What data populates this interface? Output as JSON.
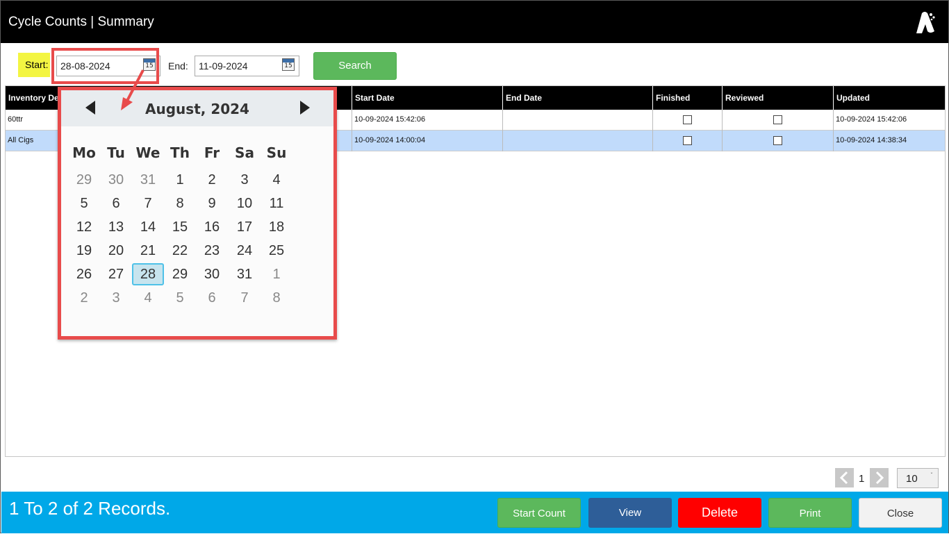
{
  "window": {
    "title": "Cycle Counts | Summary"
  },
  "filters": {
    "start_label": "Start:",
    "start_value": "28-08-2024",
    "end_label": "End:",
    "end_value": "11-09-2024",
    "calendar_icon_text": "15",
    "search_label": "Search"
  },
  "table": {
    "columns": [
      "Inventory De",
      "Start Date",
      "End Date",
      "Finished",
      "Reviewed",
      "Updated"
    ],
    "rows": [
      {
        "name": "60ttr",
        "start_date": "10-09-2024 15:42:06",
        "end_date": "",
        "finished": false,
        "reviewed": false,
        "updated": "10-09-2024 15:42:06"
      },
      {
        "name": "All Cigs",
        "start_date": "10-09-2024 14:00:04",
        "end_date": "",
        "finished": false,
        "reviewed": false,
        "updated": "10-09-2024 14:38:34"
      }
    ]
  },
  "calendar": {
    "title": "August, 2024",
    "weekdays": [
      "Mo",
      "Tu",
      "We",
      "Th",
      "Fr",
      "Sa",
      "Su"
    ],
    "weeks": [
      [
        "29",
        "30",
        "31",
        "1",
        "2",
        "3",
        "4"
      ],
      [
        "5",
        "6",
        "7",
        "8",
        "9",
        "10",
        "11"
      ],
      [
        "12",
        "13",
        "14",
        "15",
        "16",
        "17",
        "18"
      ],
      [
        "19",
        "20",
        "21",
        "22",
        "23",
        "24",
        "25"
      ],
      [
        "26",
        "27",
        "28",
        "29",
        "30",
        "31",
        "1"
      ],
      [
        "2",
        "3",
        "4",
        "5",
        "6",
        "7",
        "8"
      ]
    ],
    "selected_day": "28"
  },
  "pager": {
    "current_page": "1",
    "page_size": "10"
  },
  "footer": {
    "records_text": "1 To 2 of 2 Records.",
    "buttons": {
      "start_count": "Start Count",
      "view": "View",
      "delete": "Delete",
      "print": "Print",
      "close": "Close"
    }
  },
  "colors": {
    "title_bar": "#000000",
    "search_green": "#5cb85c",
    "footer_blue": "#00a8e8",
    "view_blue": "#2e5e98",
    "delete_red": "#ff0000",
    "annotation_red": "#e84b4b",
    "start_label_highlight": "#f3f542",
    "selected_row": "#c1dbfb"
  }
}
